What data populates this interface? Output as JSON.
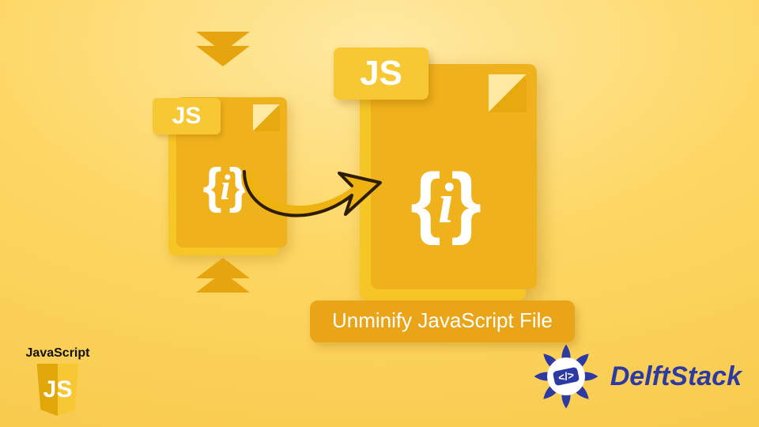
{
  "caption": "Unminify JavaScript File",
  "small_file": {
    "tag": "JS",
    "brace_open": "{",
    "semi": "i",
    "brace_close": "}"
  },
  "large_file": {
    "tag": "JS",
    "brace_open": "{",
    "semi": "i",
    "brace_close": "}"
  },
  "js_logo": {
    "word": "JavaScript",
    "shield_text": "JS"
  },
  "delft": {
    "brand": "DelftStack",
    "tag_open": "<",
    "slash": "/",
    "tag_close": ">"
  },
  "colors": {
    "bg_inner": "#ffe9a3",
    "bg_outer": "#f7c84a",
    "file": "#f5c626",
    "file_dark": "#e6a90f",
    "caption_bg": "#e9a418",
    "arrow_fill": "#eeb211",
    "arrow_stroke": "#2d1e02",
    "brand_blue": "#2d3aa3"
  }
}
